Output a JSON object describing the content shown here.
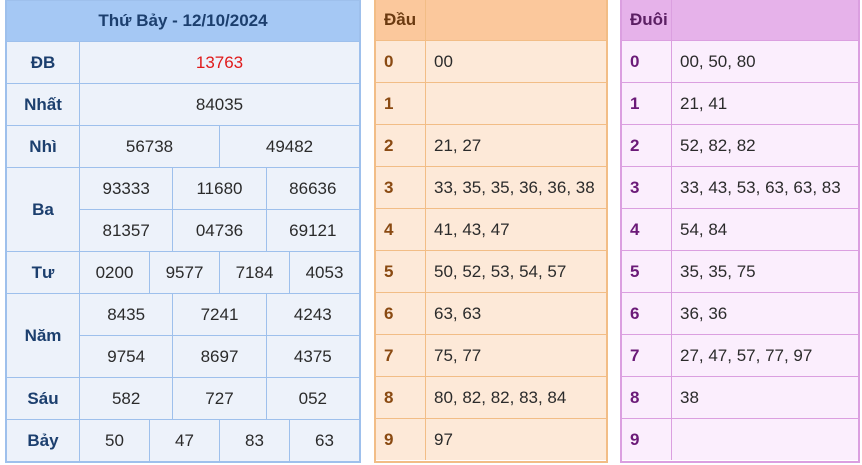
{
  "results": {
    "title": "Thứ Bảy - 12/10/2024",
    "prizes": [
      {
        "label": "ĐB",
        "rows": [
          [
            "13763"
          ]
        ],
        "special": true
      },
      {
        "label": "Nhất",
        "rows": [
          [
            "84035"
          ]
        ]
      },
      {
        "label": "Nhì",
        "rows": [
          [
            "56738",
            "49482"
          ]
        ]
      },
      {
        "label": "Ba",
        "rows": [
          [
            "93333",
            "11680",
            "86636"
          ],
          [
            "81357",
            "04736",
            "69121"
          ]
        ]
      },
      {
        "label": "Tư",
        "rows": [
          [
            "0200",
            "9577",
            "7184",
            "4053"
          ]
        ]
      },
      {
        "label": "Năm",
        "rows": [
          [
            "8435",
            "7241",
            "4243"
          ],
          [
            "9754",
            "8697",
            "4375"
          ]
        ]
      },
      {
        "label": "Sáu",
        "rows": [
          [
            "582",
            "727",
            "052"
          ]
        ]
      },
      {
        "label": "Bảy",
        "rows": [
          [
            "50",
            "47",
            "83",
            "63"
          ]
        ]
      }
    ]
  },
  "dau": {
    "title": "Đầu",
    "rows": [
      {
        "k": "0",
        "v": "00"
      },
      {
        "k": "1",
        "v": ""
      },
      {
        "k": "2",
        "v": "21, 27"
      },
      {
        "k": "3",
        "v": "33, 35, 35, 36, 36, 38"
      },
      {
        "k": "4",
        "v": "41, 43, 47"
      },
      {
        "k": "5",
        "v": "50, 52, 53, 54, 57"
      },
      {
        "k": "6",
        "v": "63, 63"
      },
      {
        "k": "7",
        "v": "75, 77"
      },
      {
        "k": "8",
        "v": "80, 82, 82, 83, 84"
      },
      {
        "k": "9",
        "v": "97"
      }
    ]
  },
  "duoi": {
    "title": "Đuôi",
    "rows": [
      {
        "k": "0",
        "v": "00, 50, 80"
      },
      {
        "k": "1",
        "v": "21, 41"
      },
      {
        "k": "2",
        "v": "52, 82, 82"
      },
      {
        "k": "3",
        "v": "33, 43, 53, 63, 63, 83"
      },
      {
        "k": "4",
        "v": "54, 84"
      },
      {
        "k": "5",
        "v": "35, 35, 75"
      },
      {
        "k": "6",
        "v": "36, 36"
      },
      {
        "k": "7",
        "v": "27, 47, 57, 77, 97"
      },
      {
        "k": "8",
        "v": "38"
      },
      {
        "k": "9",
        "v": ""
      }
    ]
  }
}
